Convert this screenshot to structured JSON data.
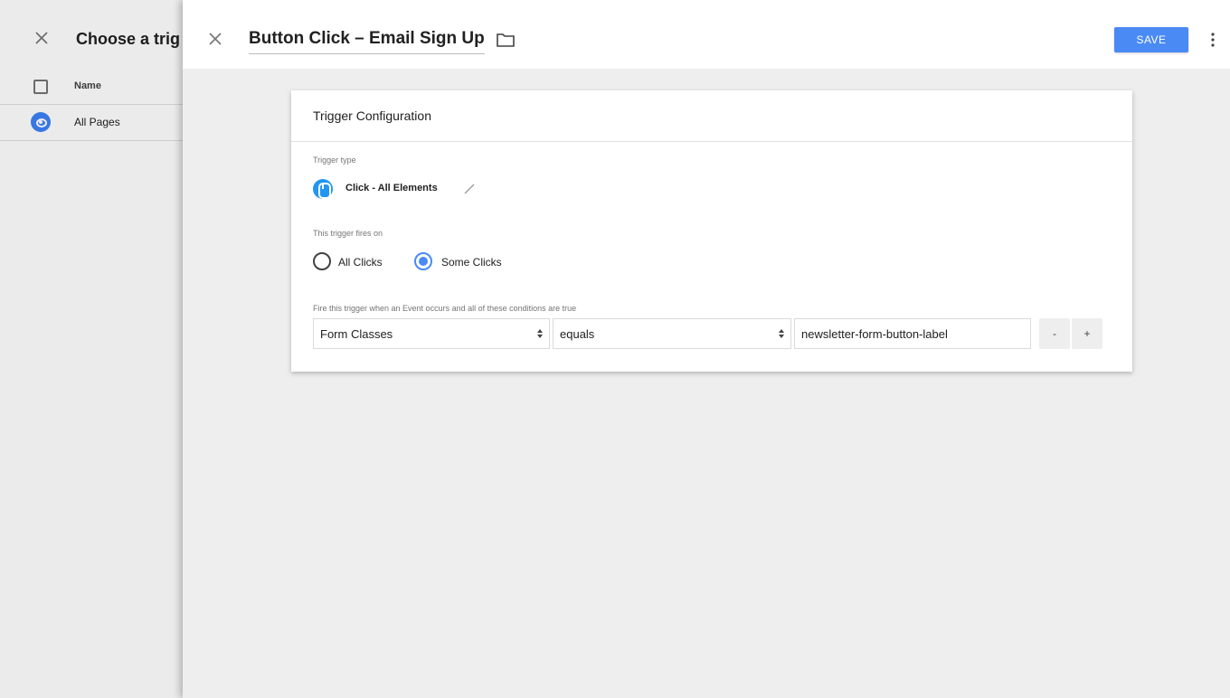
{
  "background_panel": {
    "title": "Choose a trig",
    "list_header": "Name",
    "items": [
      {
        "label": "All Pages",
        "icon": "eye-icon"
      }
    ]
  },
  "sheet": {
    "title": "Button Click – Email Sign Up",
    "save_label": "SAVE"
  },
  "card": {
    "title": "Trigger Configuration",
    "trigger_type_label": "Trigger type",
    "trigger_type_name": "Click - All Elements",
    "fires_on_label": "This trigger fires on",
    "fires_on_options": [
      {
        "label": "All Clicks",
        "selected": false
      },
      {
        "label": "Some Clicks",
        "selected": true
      }
    ],
    "conditions_label": "Fire this trigger when an Event occurs and all of these conditions are true",
    "condition": {
      "variable": "Form Classes",
      "operator": "equals",
      "value": "newsletter-form-button-label",
      "remove_label": "-",
      "add_label": "+"
    }
  },
  "colors": {
    "accent": "#4a8af4",
    "trigger_icon": "#2196f3",
    "sheet_background": "#eeeeee"
  }
}
